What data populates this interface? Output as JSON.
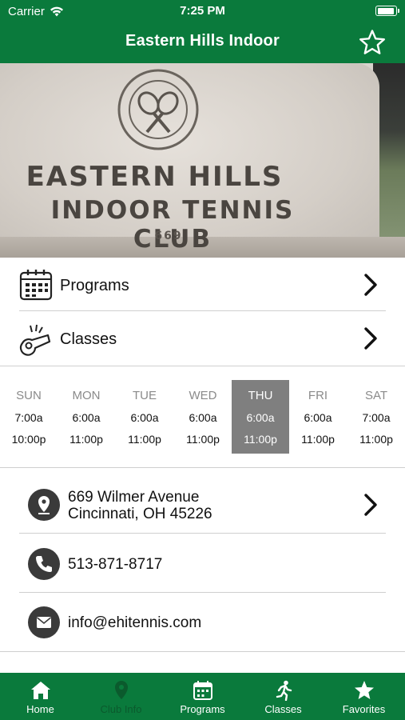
{
  "status_bar": {
    "carrier": "Carrier",
    "time": "7:25 PM"
  },
  "nav": {
    "title": "Eastern Hills Indoor",
    "favorite_icon": "star-outline-icon"
  },
  "hero": {
    "emblem_text": "EASTERN HILLS INDOOR TENNIS CLUB",
    "line1": "EASTERN HILLS",
    "line2": "INDOOR TENNIS CLUB",
    "line3": "669"
  },
  "menu": [
    {
      "label": "Programs",
      "icon": "calendar-icon"
    },
    {
      "label": "Classes",
      "icon": "whistle-icon"
    }
  ],
  "hours": [
    {
      "day": "SUN",
      "open": "7:00a",
      "close": "10:00p",
      "today": false
    },
    {
      "day": "MON",
      "open": "6:00a",
      "close": "11:00p",
      "today": false
    },
    {
      "day": "TUE",
      "open": "6:00a",
      "close": "11:00p",
      "today": false
    },
    {
      "day": "WED",
      "open": "6:00a",
      "close": "11:00p",
      "today": false
    },
    {
      "day": "THU",
      "open": "6:00a",
      "close": "11:00p",
      "today": true
    },
    {
      "day": "FRI",
      "open": "6:00a",
      "close": "11:00p",
      "today": false
    },
    {
      "day": "SAT",
      "open": "7:00a",
      "close": "11:00p",
      "today": false
    }
  ],
  "contact": {
    "address_line1": "669 Wilmer Avenue",
    "address_line2": "Cincinnati, OH 45226",
    "phone": "513-871-8717",
    "email": "info@ehitennis.com"
  },
  "tabs": [
    {
      "label": "Home",
      "icon": "home-icon",
      "active": false
    },
    {
      "label": "Club Info",
      "icon": "map-pin-icon",
      "active": true
    },
    {
      "label": "Programs",
      "icon": "calendar-icon",
      "active": false
    },
    {
      "label": "Classes",
      "icon": "runner-icon",
      "active": false
    },
    {
      "label": "Favorites",
      "icon": "star-icon",
      "active": false
    }
  ],
  "colors": {
    "brand_green": "#0a7a3c",
    "today_highlight": "#7f7f7f",
    "active_tab_label": "#0b5a2d"
  }
}
